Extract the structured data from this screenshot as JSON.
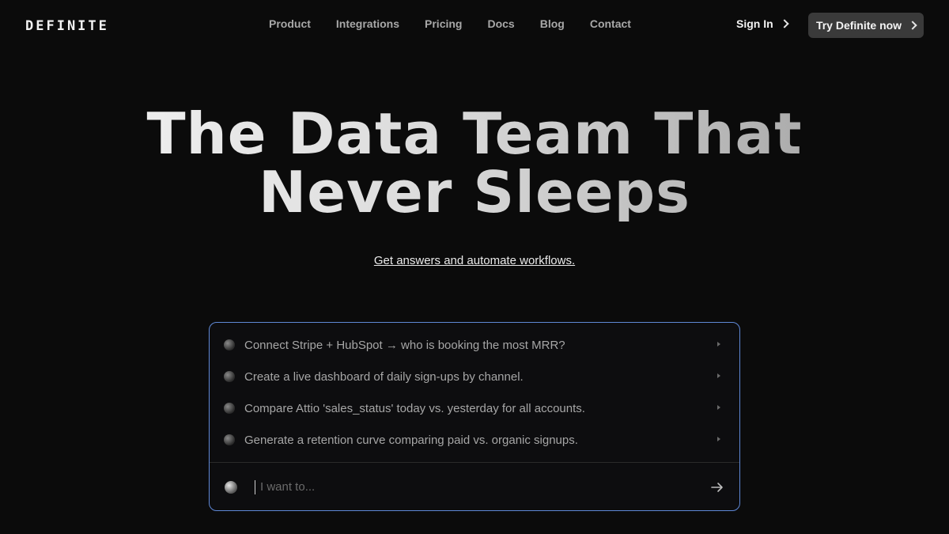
{
  "brand": {
    "logo_text": "DEFINITE"
  },
  "nav": {
    "links": [
      "Product",
      "Integrations",
      "Pricing",
      "Docs",
      "Blog",
      "Contact"
    ],
    "sign_in": "Sign In",
    "cta": "Try Definite now"
  },
  "hero": {
    "title_line1": "The Data Team That",
    "title_line2": "Never Sleeps",
    "subtitle": "Get answers and automate workflows."
  },
  "prompt": {
    "suggestions": [
      "Connect Stripe + HubSpot → who is booking the most MRR?",
      "Create a live dashboard of daily sign-ups by channel.",
      "Compare Attio 'sales_status' today vs. yesterday for all accounts.",
      "Generate a retention curve comparing paid vs. organic signups."
    ],
    "input_placeholder": "I want to...",
    "input_value": ""
  },
  "colors": {
    "background": "#0b0b0b",
    "accent_border": "#5f88d6",
    "cta_bg": "#3a3a3a"
  },
  "icons": [
    "chevron-right-icon",
    "orb-icon",
    "arrow-right-icon"
  ]
}
